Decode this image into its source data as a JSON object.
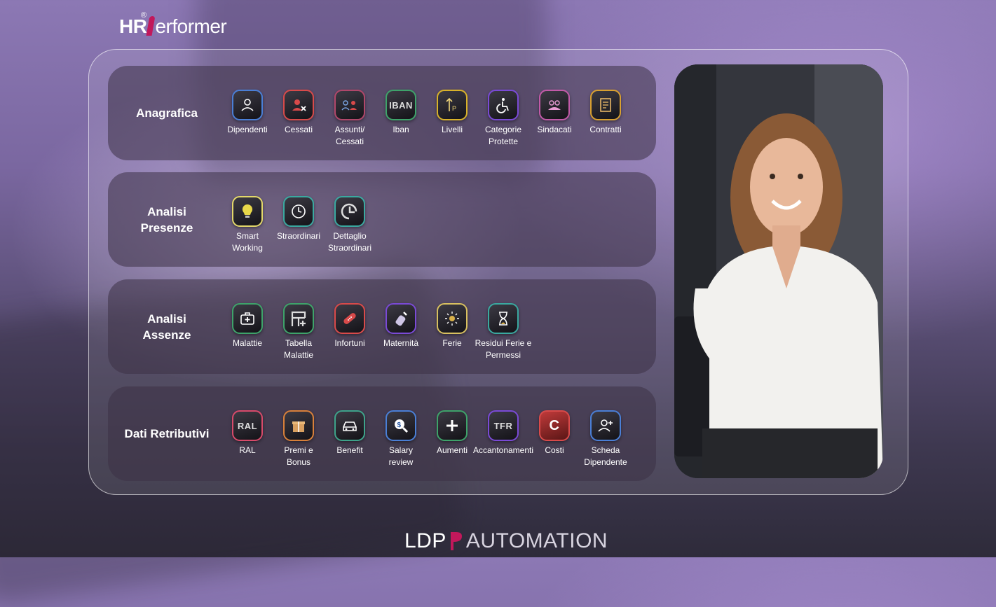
{
  "logo": {
    "hr": "HR",
    "reg": "®",
    "rest": "erformer"
  },
  "sections": [
    {
      "title": "Anagrafica",
      "items": [
        {
          "label": "Dipendenti",
          "icon": "person-icon",
          "color": "#4a7fd6"
        },
        {
          "label": "Cessati",
          "icon": "person-remove-icon",
          "color": "#d84a4a"
        },
        {
          "label": "Assunti/\nCessati",
          "icon": "persons-in-out-icon",
          "color": "#b0476a"
        },
        {
          "label": "Iban",
          "icon": "iban-icon",
          "text": "IBAN",
          "color": "#3ea36a"
        },
        {
          "label": "Livelli",
          "icon": "level-up-icon",
          "color": "#d8b22a"
        },
        {
          "label": "Categorie\nProtette",
          "icon": "wheelchair-icon",
          "color": "#7a4ad6"
        },
        {
          "label": "Sindacati",
          "icon": "group-icon",
          "color": "#c25aa8"
        },
        {
          "label": "Contratti",
          "icon": "contract-icon",
          "color": "#d8a030"
        }
      ]
    },
    {
      "title": "Analisi Presenze",
      "items": [
        {
          "label": "Smart\nWorking",
          "icon": "lightbulb-icon",
          "color": "#e3d86a"
        },
        {
          "label": "Straordinari",
          "icon": "clock-icon",
          "color": "#3aa9a0"
        },
        {
          "label": "Dettaglio\nStraordinari",
          "icon": "clock-detail-icon",
          "color": "#3aa9a0"
        }
      ]
    },
    {
      "title": "Analisi Assenze",
      "items": [
        {
          "label": "Malattie",
          "icon": "medkit-icon",
          "color": "#3ea36a"
        },
        {
          "label": "Tabella\nMalattie",
          "icon": "medical-table-icon",
          "color": "#3ea36a"
        },
        {
          "label": "Infortuni",
          "icon": "bandage-icon",
          "color": "#d84a4a"
        },
        {
          "label": "Maternità",
          "icon": "baby-bottle-icon",
          "color": "#7a4ad6"
        },
        {
          "label": "Ferie",
          "icon": "sun-icon",
          "color": "#d8c060"
        },
        {
          "label": "Residui Ferie e\nPermessi",
          "icon": "hourglass-icon",
          "color": "#3aa9a0"
        }
      ]
    },
    {
      "title": "Dati Retributivi",
      "items": [
        {
          "label": "RAL",
          "icon": "ral-icon",
          "text": "RAL",
          "color": "#d84a6a"
        },
        {
          "label": "Premi e\nBonus",
          "icon": "gift-icon",
          "color": "#d8803a"
        },
        {
          "label": "Benefit",
          "icon": "car-icon",
          "color": "#3ea38a"
        },
        {
          "label": "Salary\nreview",
          "icon": "search-dollar-icon",
          "color": "#4a7fd6"
        },
        {
          "label": "Aumenti",
          "icon": "plus-icon",
          "color": "#3ea36a"
        },
        {
          "label": "Accantonamenti",
          "icon": "tfr-icon",
          "text": "TFR",
          "color": "#7a4ad6"
        },
        {
          "label": "Costi",
          "icon": "cost-icon",
          "text": "C",
          "color": "#d84a4a"
        },
        {
          "label": "Scheda\nDipendente",
          "icon": "person-add-icon",
          "color": "#4a7fd6"
        }
      ]
    }
  ],
  "footer": {
    "ldp": "LDP",
    "automation": "AUTOMATION"
  }
}
